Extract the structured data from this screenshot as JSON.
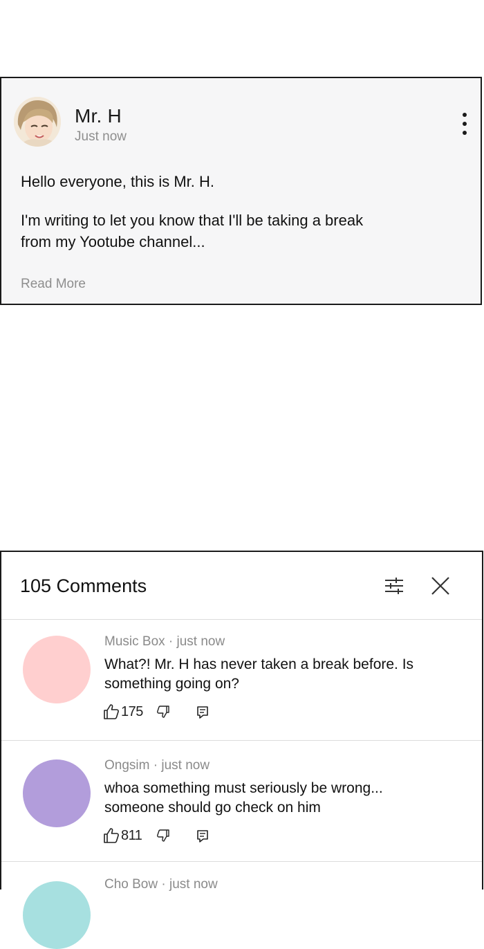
{
  "post": {
    "author": "Mr. H",
    "time": "Just now",
    "line1": "Hello everyone, this is Mr. H.",
    "line2": "I'm writing to let you know that I'll be taking a break from my Yootube channel...",
    "read_more": "Read More"
  },
  "comments": {
    "title": "105 Comments",
    "items": [
      {
        "meta": "Music Box · just now",
        "text": "What?! Mr. H has never taken a break before. Is something going on?",
        "likes": "175",
        "avatar_color": "#ffcfcf"
      },
      {
        "meta": "Ongsim · just now",
        "text": "whoa something must seriously be wrong... someone should go check on him",
        "likes": "811",
        "avatar_color": "#b29ddb"
      },
      {
        "meta": "Cho Bow · just now",
        "avatar_color": "#a7e0e0"
      }
    ]
  },
  "icons": {
    "menu": "more-vert-icon",
    "filter": "sliders-icon",
    "close": "close-icon",
    "like": "thumbs-up-icon",
    "dislike": "thumbs-down-icon",
    "reply": "comment-icon"
  }
}
